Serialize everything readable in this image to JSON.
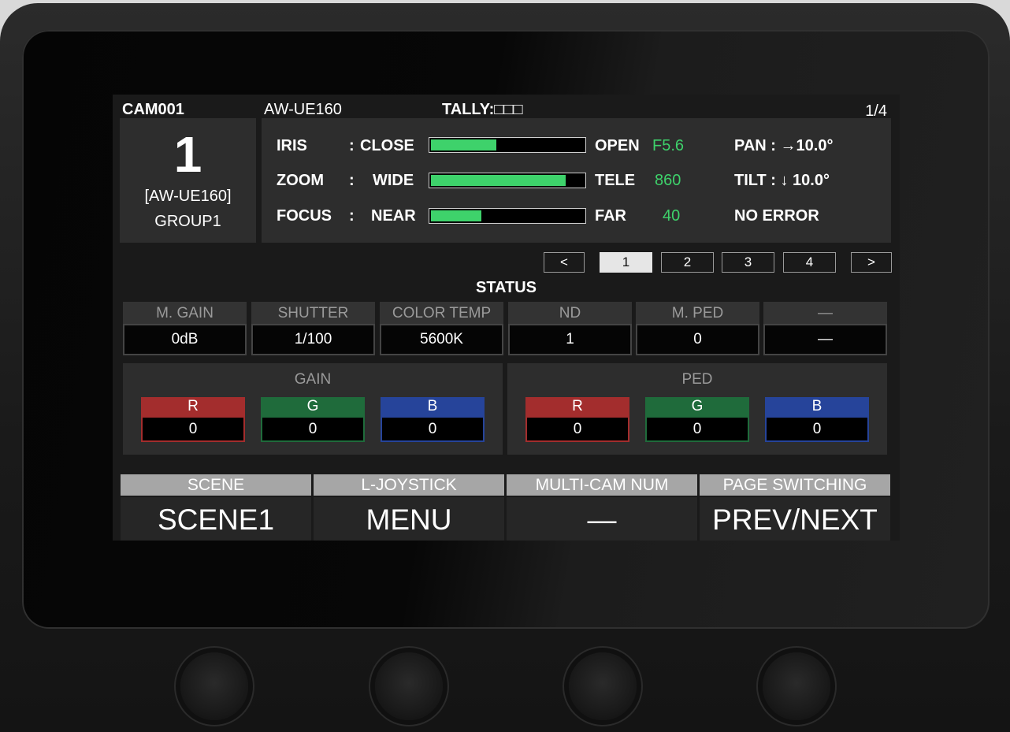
{
  "header": {
    "cam_id": "CAM001",
    "model": "AW-UE160",
    "tally_label": "TALLY:□□□",
    "page_indicator": "1/4"
  },
  "camera_box": {
    "number": "1",
    "model": "[AW-UE160]",
    "group": "GROUP1"
  },
  "lens": {
    "iris": {
      "label": "IRIS",
      "sep": ":",
      "min_label": "CLOSE",
      "max_label": "OPEN",
      "value": "F5.6",
      "level": 0.43
    },
    "zoom": {
      "label": "ZOOM",
      "sep": ":",
      "min_label": "WIDE",
      "max_label": "TELE",
      "value": "860",
      "level": 0.88
    },
    "focus": {
      "label": "FOCUS",
      "sep": ":",
      "min_label": "NEAR",
      "max_label": "FAR",
      "value": "40",
      "level": 0.33
    }
  },
  "position": {
    "pan": "PAN : →10.0°",
    "tilt": "TILT : ↓ 10.0°",
    "error": "NO ERROR"
  },
  "pager": {
    "prev": "<",
    "next": ">",
    "pages": [
      "1",
      "2",
      "3",
      "4"
    ],
    "active_page": "1"
  },
  "status": {
    "title": "STATUS",
    "cells": [
      {
        "label": "M. GAIN",
        "value": "0dB"
      },
      {
        "label": "SHUTTER",
        "value": "1/100"
      },
      {
        "label": "COLOR TEMP",
        "value": "5600K"
      },
      {
        "label": "ND",
        "value": "1"
      },
      {
        "label": "M. PED",
        "value": "0"
      },
      {
        "label": "—",
        "value": "—"
      }
    ]
  },
  "gain": {
    "title": "GAIN",
    "r": {
      "label": "R",
      "value": "0"
    },
    "g": {
      "label": "G",
      "value": "0"
    },
    "b": {
      "label": "B",
      "value": "0"
    }
  },
  "ped": {
    "title": "PED",
    "r": {
      "label": "R",
      "value": "0"
    },
    "g": {
      "label": "G",
      "value": "0"
    },
    "b": {
      "label": "B",
      "value": "0"
    }
  },
  "function_keys": [
    {
      "label": "SCENE",
      "value": "SCENE1"
    },
    {
      "label": "L-JOYSTICK",
      "value": "MENU"
    },
    {
      "label": "MULTI-CAM NUM",
      "value": "—"
    },
    {
      "label": "PAGE SWITCHING",
      "value": "PREV/NEXT"
    }
  ],
  "colors": {
    "bar_green": "#3ed26b",
    "red": "#a32d2d",
    "green": "#1f6b3b",
    "blue": "#26449a"
  }
}
